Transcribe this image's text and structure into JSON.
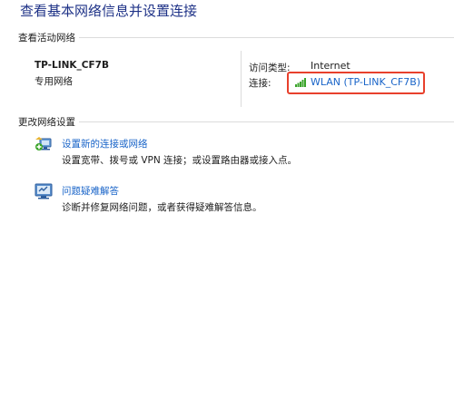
{
  "page": {
    "title": "查看基本网络信息并设置连接"
  },
  "active_networks": {
    "section_label": "查看活动网络",
    "network_name": "TP-LINK_CF7B",
    "network_category": "专用网络",
    "access_type_label": "访问类型:",
    "access_type_value": "Internet",
    "connections_label": "连接:",
    "connection_link": "WLAN (TP-LINK_CF7B)",
    "connection_icon": "wifi-signal-icon",
    "highlight_color": "#e8402c"
  },
  "change_settings": {
    "section_label": "更改网络设置",
    "tasks": [
      {
        "icon": "network-setup-icon",
        "title": "设置新的连接或网络",
        "description": "设置宽带、拨号或 VPN 连接；或设置路由器或接入点。"
      },
      {
        "icon": "troubleshoot-icon",
        "title": "问题疑难解答",
        "description": "诊断并修复网络问题，或者获得疑难解答信息。"
      }
    ]
  },
  "colors": {
    "title": "#1e3287",
    "link": "#1964c8",
    "text": "#1e1e1e",
    "divider": "#dcdcdc",
    "signal": "#3aa42a"
  }
}
